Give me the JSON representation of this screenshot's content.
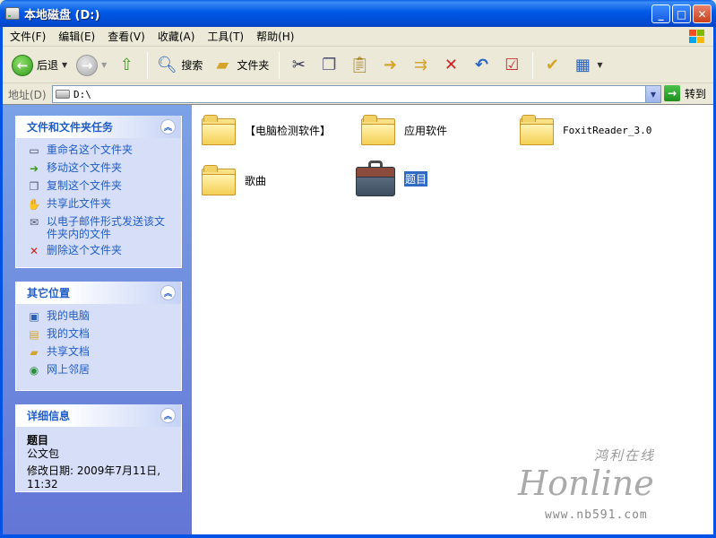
{
  "window": {
    "title": "本地磁盘 (D:)"
  },
  "menu": [
    "文件(F)",
    "编辑(E)",
    "查看(V)",
    "收藏(A)",
    "工具(T)",
    "帮助(H)"
  ],
  "toolbar": {
    "back": "后退",
    "search": "搜索",
    "folders": "文件夹"
  },
  "address": {
    "label": "地址(D)",
    "value": "D:\\",
    "go": "转到"
  },
  "tasks_panel": {
    "title": "文件和文件夹任务",
    "items": [
      "重命名这个文件夹",
      "移动这个文件夹",
      "复制这个文件夹",
      "共享此文件夹",
      "以电子邮件形式发送该文件夹内的文件",
      "删除这个文件夹"
    ]
  },
  "places_panel": {
    "title": "其它位置",
    "items": [
      "我的电脑",
      "我的文档",
      "共享文档",
      "网上邻居"
    ]
  },
  "details_panel": {
    "title": "详细信息",
    "name": "题目",
    "type": "公文包",
    "modified": "修改日期: 2009年7月11日, 11:32"
  },
  "files": [
    {
      "name": "【电脑检测软件】",
      "kind": "folder"
    },
    {
      "name": "应用软件",
      "kind": "folder"
    },
    {
      "name": "FoxitReader_3.0",
      "kind": "folder"
    },
    {
      "name": "歌曲",
      "kind": "folder"
    },
    {
      "name": "题目",
      "kind": "briefcase"
    }
  ],
  "watermark": {
    "cn": "鸿利在线",
    "en": "Honline",
    "url": "www.nb591.com"
  },
  "colors": {
    "titlebar": "#0058e6",
    "link": "#215dc6",
    "selection": "#316ac5"
  }
}
